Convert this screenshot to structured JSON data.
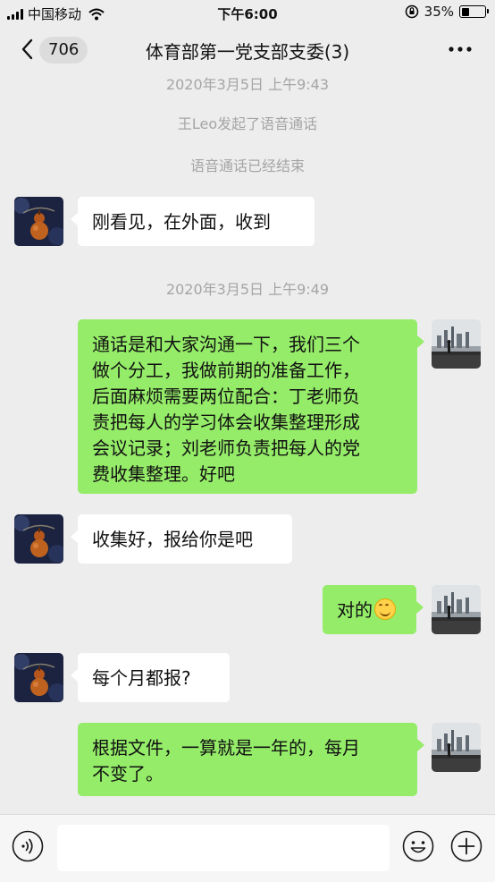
{
  "status_bar": {
    "carrier": "中国移动",
    "time": "下午6:00",
    "battery_percent": "35%",
    "battery_level": 0.35
  },
  "header": {
    "back_count": "706",
    "title": "体育部第一党支部支委(3)"
  },
  "messages": {
    "sys1": "2020年3月5日 上午9:43",
    "sys2": "王Leo发起了语音通话",
    "sys3": "语音通话已经结束",
    "m1": "刚看见，在外面，收到",
    "sys4": "2020年3月5日 上午9:49",
    "m2_lines": [
      "通话是和大家沟通一下，我们三个",
      "做个分工，我做前期的准备工作，",
      "后面麻烦需要两位配合：丁老师负",
      "责把每人的学习体会收集整理形成",
      "会议记录；刘老师负责把每人的党",
      "费收集整理。好吧"
    ],
    "m3": "收集好，报给你是吧",
    "m4": "对的",
    "m5": "每个月都报?",
    "m6_lines": [
      "根据文件，一算就是一年的，每月",
      "不变了。"
    ]
  },
  "icons": {
    "left_avatar": "gourd-avatar",
    "right_avatar": "city-skyline-avatar",
    "emoji": "smile-emoji",
    "voice": "voice-icon",
    "emoji_button": "emoji-icon",
    "plus": "plus-icon"
  },
  "input": {
    "placeholder": ""
  },
  "colors": {
    "background": "#ededed",
    "sent_bubble": "#95ec69",
    "received_bubble": "#ffffff",
    "system_text": "#a5a5a5"
  }
}
